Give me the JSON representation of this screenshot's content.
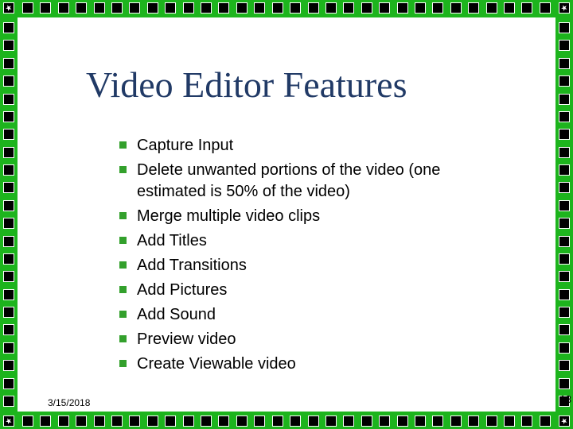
{
  "title": "Video Editor Features",
  "bullets": {
    "items": [
      "Capture Input",
      "Delete unwanted portions of the video (one estimated is 50% of the video)",
      "Merge multiple video clips",
      "Add Titles",
      "Add Transitions",
      "Add Pictures",
      "Add Sound",
      "Preview video",
      "Create Viewable video"
    ]
  },
  "footer": {
    "date": "3/15/2018",
    "page": "13"
  }
}
